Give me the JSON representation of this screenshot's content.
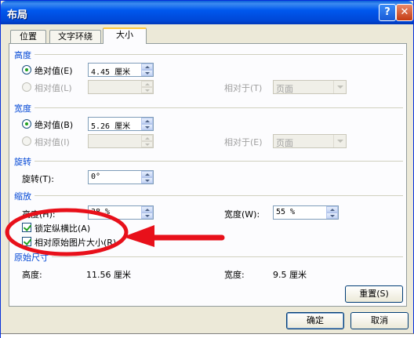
{
  "window": {
    "title": "布局",
    "help_glyph": "?",
    "close_glyph": "✕"
  },
  "tabs": [
    {
      "label": "位置"
    },
    {
      "label": "文字环绕"
    },
    {
      "label": "大小",
      "active": true
    }
  ],
  "height": {
    "section": "高度",
    "absolute_label": "绝对值(E)",
    "absolute_value": "4.45 厘米",
    "relative_label": "相对值(L)",
    "relative_to_label": "相对于(T)",
    "relative_to_value": "页面"
  },
  "width": {
    "section": "宽度",
    "absolute_label": "绝对值(B)",
    "absolute_value": "5.26 厘米",
    "relative_label": "相对值(I)",
    "relative_to_label": "相对于(E)",
    "relative_to_value": "页面"
  },
  "rotation": {
    "section": "旋转",
    "label": "旋转(T):",
    "value": "0°"
  },
  "scale": {
    "section": "缩放",
    "height_label": "高度(H):",
    "height_value": "38 %",
    "width_label": "宽度(W):",
    "width_value": "55 %",
    "lock_aspect_label": "锁定纵横比(A)",
    "lock_aspect_checked": true,
    "relative_original_label": "相对原始图片大小(R)",
    "relative_original_checked": true
  },
  "original_size": {
    "section": "原始尺寸",
    "height_label": "高度:",
    "height_value": "11.56 厘米",
    "width_label": "宽度:",
    "width_value": "9.5 厘米"
  },
  "buttons": {
    "reset": "重置(S)",
    "ok": "确定",
    "cancel": "取消"
  },
  "colors": {
    "titlebar": "#0058ee",
    "section_text": "#0046d5",
    "annotation": "#e8101a"
  }
}
